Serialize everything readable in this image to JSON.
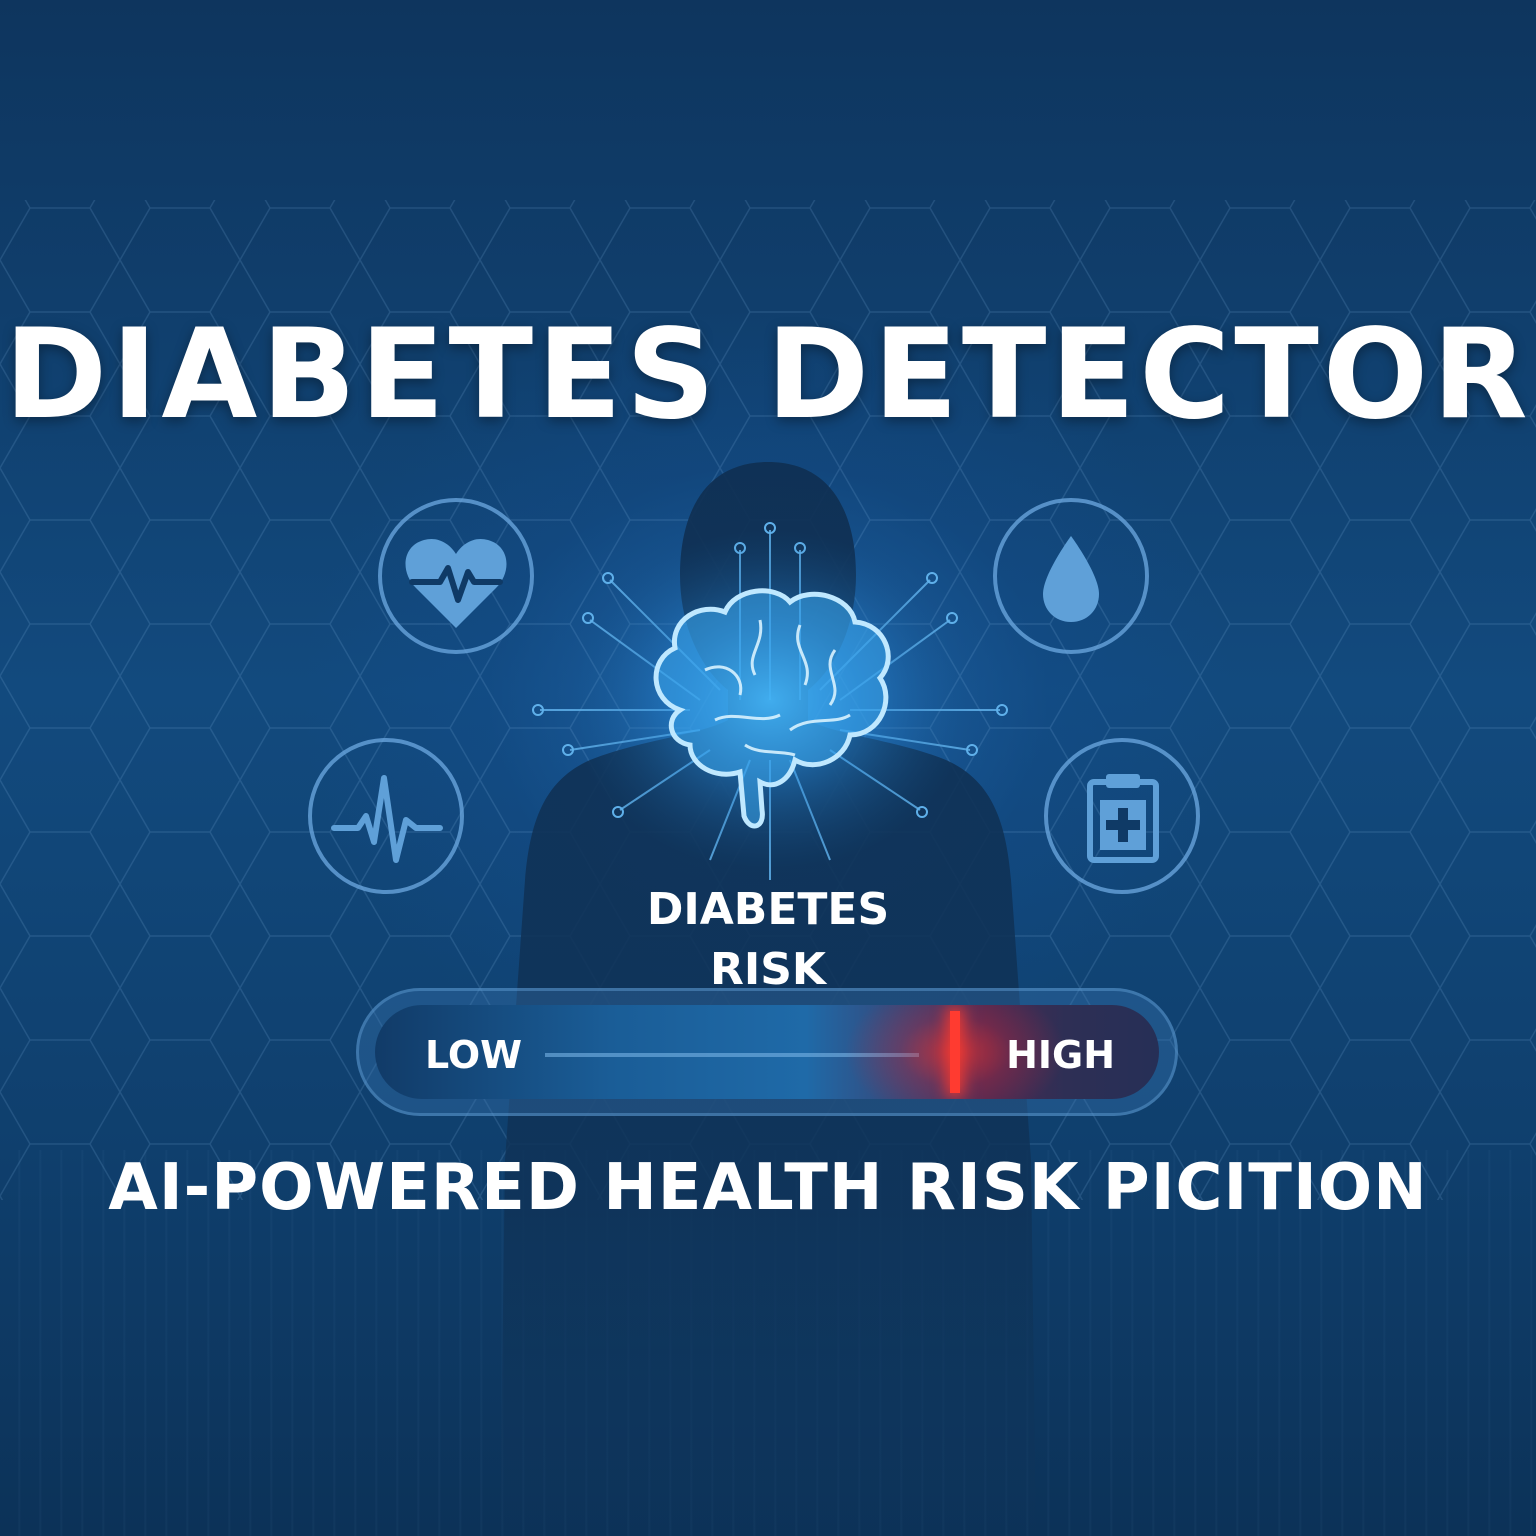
{
  "title": "DIABETES DETECTOR",
  "subtitle": "AI-POWERED HEALTH RISK PICITION",
  "risk": {
    "label_line1": "DIABETES",
    "label_line2": "RISK",
    "low_label": "LOW",
    "high_label": "HIGH",
    "level": 0.74
  },
  "icons": [
    "heart-rate-icon",
    "blood-drop-icon",
    "pulse-icon",
    "medical-clipboard-icon",
    "brain-icon",
    "human-silhouette"
  ],
  "colors": {
    "background": "#0d3a66",
    "accent": "#6eaae1",
    "brain_glow": "#3fb6ff",
    "risk_marker": "#ff3b30",
    "text": "#ffffff"
  }
}
